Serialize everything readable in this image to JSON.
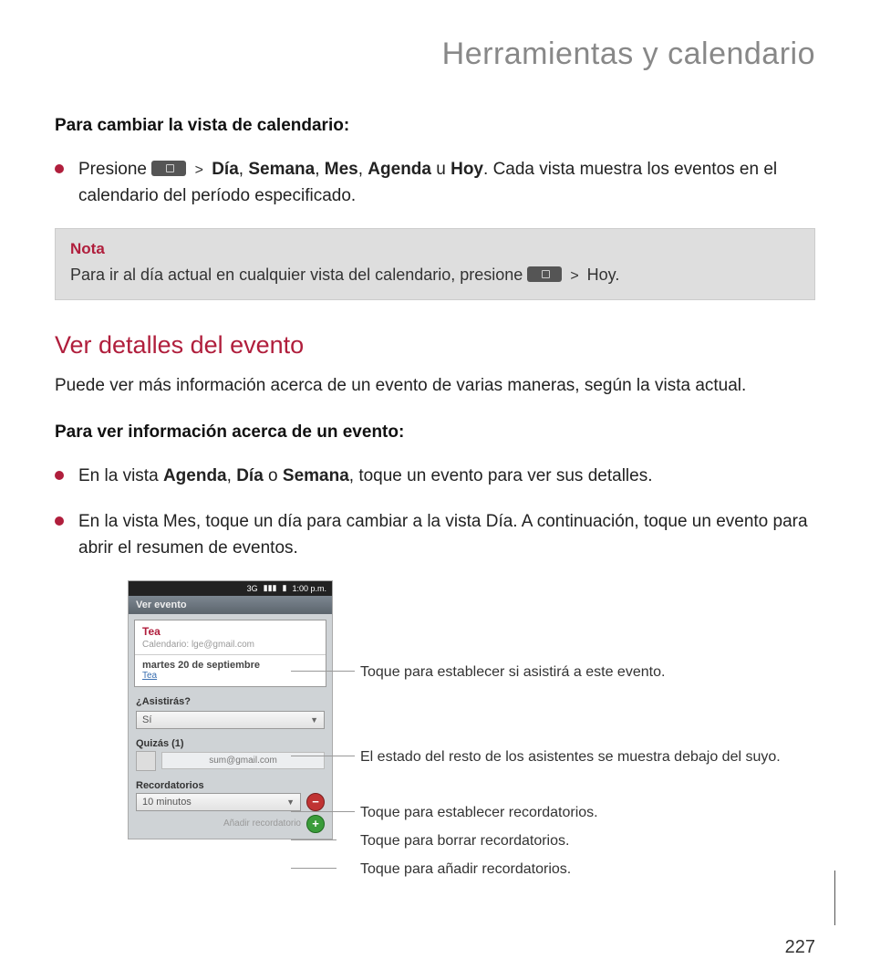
{
  "page_title": "Herramientas y calendario",
  "sub1": "Para cambiar la vista de calendario:",
  "bullet1_parts": {
    "pre": "Presione ",
    "gt": ">",
    "dia": "Día",
    "sep": ", ",
    "semana": "Semana",
    "mes": "Mes",
    "agenda": "Agenda",
    "u": " u ",
    "hoy": "Hoy",
    "post": ". Cada vista muestra los eventos en el calendario del período especificado."
  },
  "note": {
    "label": "Nota",
    "text_pre": "Para ir al día actual en cualquier vista del calendario, presione ",
    "gt": ">",
    "text_post": " Hoy."
  },
  "section_title": "Ver detalles del evento",
  "section_para": "Puede ver más información acerca de un evento de varias maneras, según la vista actual.",
  "sub2": "Para ver información acerca de un evento:",
  "bullet2_parts": {
    "pre": "En la vista ",
    "agenda": "Agenda",
    "sep1": ", ",
    "dia": "Día",
    "o": " o ",
    "semana": "Semana",
    "post": ", toque un evento para ver sus detalles."
  },
  "bullet3": "En la vista Mes, toque un día para cambiar a la vista Día. A continuación, toque un evento para abrir el resumen de eventos.",
  "phone": {
    "time": "1:00 p.m.",
    "appbar": "Ver evento",
    "event_title": "Tea",
    "calendar_label": "Calendario:",
    "calendar_value": "lge@gmail.com",
    "date": "martes 20 de septiembre",
    "link": "Tea",
    "attend_label": "¿Asistirás?",
    "attend_value": "Sí",
    "maybe_label": "Quizás (1)",
    "attendee_email": "sum@gmail.com",
    "reminders_label": "Recordatorios",
    "reminder_value": "10 minutos",
    "add_reminder": "Añadir recordatorio"
  },
  "callouts": {
    "c1": "Toque para establecer si asistirá a este evento.",
    "c2": "El estado del resto de los asistentes se muestra debajo del suyo.",
    "c3": "Toque para establecer recordatorios.",
    "c4": "Toque para borrar recordatorios.",
    "c5": "Toque para añadir recordatorios."
  },
  "page_number": "227"
}
